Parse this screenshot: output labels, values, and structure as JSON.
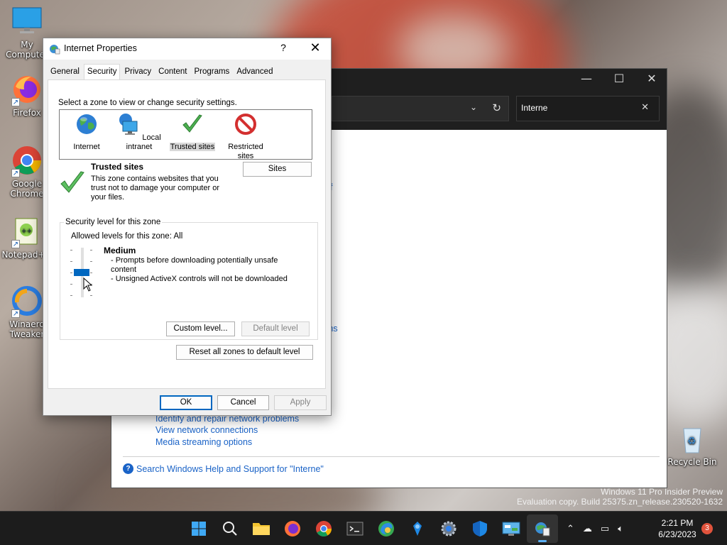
{
  "desktop": {
    "icons": [
      {
        "label": "My Computer",
        "icon": "computer-icon"
      },
      {
        "label": "Firefox",
        "icon": "firefox-icon"
      },
      {
        "label": "Google Chrome",
        "icon": "chrome-icon"
      },
      {
        "label": "Notepad++",
        "icon": "notepad-plus-plus-icon"
      },
      {
        "label": "Winaero Tweaker",
        "icon": "winaero-tweaker-icon"
      },
      {
        "label": "Recycle Bin",
        "icon": "recycle-bin-icon"
      }
    ],
    "watermark": {
      "line1": "Windows 11 Pro Insider Preview",
      "line2": "Evaluation copy. Build 25375.zn_release.230520-1632"
    }
  },
  "explorer": {
    "search_value": "Interne",
    "links": [
      "Identify and repair network problems",
      "View network connections",
      "Media streaming options"
    ],
    "partial_link_1": "f",
    "partial_link_2": "ms",
    "help_link": "Search Windows Help and Support for \"Interne\""
  },
  "dialog": {
    "title": "Internet Properties",
    "help_glyph": "?",
    "tabs": [
      "General",
      "Security",
      "Privacy",
      "Content",
      "Programs",
      "Advanced"
    ],
    "active_tab": "Security",
    "zone_prompt": "Select a zone to view or change security settings.",
    "zones": [
      {
        "label": "Internet",
        "icon": "globe-icon"
      },
      {
        "label": "Local intranet",
        "icon": "network-monitor-icon"
      },
      {
        "label": "Trusted sites",
        "icon": "checkmark-icon"
      },
      {
        "label": "Restricted sites",
        "icon": "restricted-icon"
      }
    ],
    "selected_zone": "Trusted sites",
    "zone_name": "Trusted sites",
    "zone_description": "This zone contains websites that you trust not to damage your computer or your files.",
    "sites_button": "Sites",
    "security_group_title": "Security level for this zone",
    "allowed_levels": "Allowed levels for this zone: All",
    "level_name": "Medium",
    "level_details": [
      "- Prompts before downloading potentially unsafe content",
      "- Unsigned ActiveX controls will not be downloaded"
    ],
    "custom_level_button": "Custom level...",
    "default_level_button": "Default level",
    "reset_button": "Reset all zones to default level",
    "ok_button": "OK",
    "cancel_button": "Cancel",
    "apply_button": "Apply"
  },
  "taskbar": {
    "apps": [
      "start-icon",
      "search-icon",
      "file-explorer-icon",
      "firefox-icon",
      "chrome-icon",
      "terminal-icon",
      "edge-beta-icon",
      "winaero-icon",
      "settings-icon",
      "defender-icon",
      "control-panel-icon",
      "internet-properties-icon"
    ],
    "time": "2:21 PM",
    "date": "6/23/2023",
    "notification_count": "3"
  }
}
